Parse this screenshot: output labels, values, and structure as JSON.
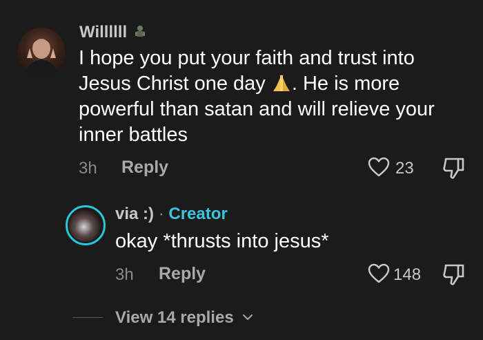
{
  "main_comment": {
    "username": "Willllll",
    "text_part1": "I hope you put your faith and trust into Jesus Christ one day ",
    "text_part2": ". He is more powerful than satan and will relieve your inner battles",
    "timestamp": "3h",
    "reply_label": "Reply",
    "like_count": "23",
    "icons": [
      "avatar",
      "badge-icon",
      "praying-hands-icon",
      "heart-icon",
      "dislike-icon"
    ]
  },
  "reply_comment": {
    "username": "via :)",
    "separator": "·",
    "creator_label": "Creator",
    "text": "okay *thrusts into jesus*",
    "timestamp": "3h",
    "reply_label": "Reply",
    "like_count": "148",
    "icons": [
      "avatar",
      "heart-icon",
      "dislike-icon"
    ]
  },
  "view_replies": {
    "label": "View 14 replies",
    "icon": "chevron-down-icon"
  },
  "colors": {
    "background": "#1b1b1b",
    "text_primary": "#ffffff",
    "text_secondary": "#a9a9a9",
    "creator_accent": "#3cc3e0",
    "avatar_ring": "#25c9d9"
  }
}
